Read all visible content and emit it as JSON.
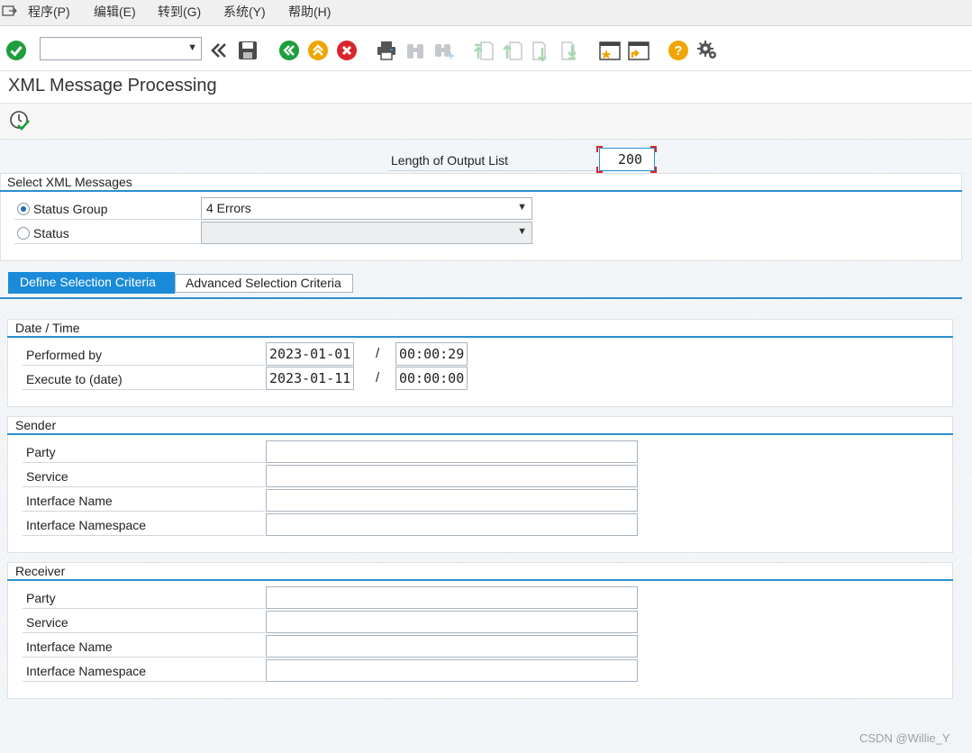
{
  "menu": {
    "items": [
      "程序(P)",
      "编辑(E)",
      "转到(G)",
      "系统(Y)",
      "帮助(H)"
    ]
  },
  "toolbar": {
    "command_value": "",
    "icons": [
      "enter-icon",
      "back-double-icon",
      "save-icon",
      "back-icon",
      "exit-icon",
      "cancel-icon",
      "print-icon",
      "find-icon",
      "find-next-icon",
      "first-page-icon",
      "previous-page-icon",
      "next-page-icon",
      "last-page-icon",
      "create-session-icon",
      "shortcut-icon",
      "help-icon",
      "settings-icon"
    ]
  },
  "page": {
    "title": "XML Message Processing"
  },
  "output": {
    "label": "Length of Output List",
    "value": "200"
  },
  "select_messages": {
    "title": "Select XML Messages",
    "status_group_label": "Status Group",
    "status_group_value": "4 Errors",
    "status_label": "Status",
    "status_value": ""
  },
  "tabs": {
    "active": "Define Selection Criteria",
    "other": "Advanced Selection Criteria"
  },
  "date_time": {
    "title": "Date / Time",
    "performed_by_label": "Performed by",
    "performed_date": "2023-01-01",
    "performed_time": "00:00:29",
    "execute_to_label": "Execute to (date)",
    "execute_date": "2023-01-11",
    "execute_time": "00:00:00",
    "separator": "/"
  },
  "sender": {
    "title": "Sender",
    "party_label": "Party",
    "service_label": "Service",
    "interface_name_label": "Interface Name",
    "interface_namespace_label": "Interface Namespace"
  },
  "receiver": {
    "title": "Receiver",
    "party_label": "Party",
    "service_label": "Service",
    "interface_name_label": "Interface Name",
    "interface_namespace_label": "Interface Namespace"
  },
  "watermark": "CSDN @Willie_Y",
  "colors": {
    "accent": "#1a8bd8",
    "ok_green": "#1e9e3c",
    "exit_orange": "#f0a500",
    "cancel_red": "#d7262e"
  }
}
